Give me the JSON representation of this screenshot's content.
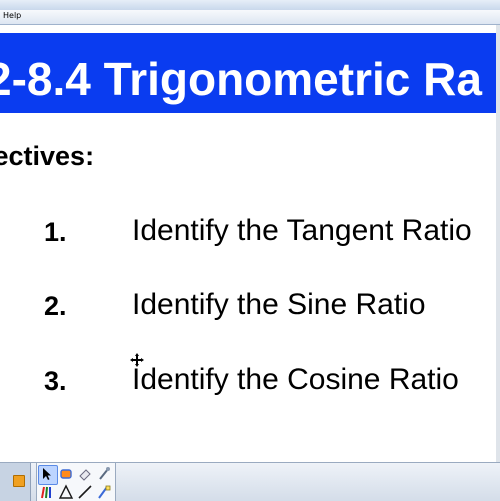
{
  "menubar": {
    "help_label": "Help"
  },
  "slide": {
    "title": "2-8.4 Trigonometric Ra",
    "objectives_heading": "jectives:",
    "items": [
      {
        "num": "1.",
        "text": "Identify the Tangent Ratio"
      },
      {
        "num": "2.",
        "text": "Identify the Sine Ratio"
      },
      {
        "num": "3.",
        "text": "Identify the Cosine Ratio"
      }
    ]
  },
  "colors": {
    "title_bg": "#0a3cf0",
    "title_text": "#ffffff",
    "body_text": "#000000"
  },
  "toolbar": {
    "icons": [
      "lock-icon",
      "select-arrow-icon",
      "pen-icon",
      "eraser-icon",
      "magic-pen-icon",
      "pens-icon",
      "shape-icon",
      "line-icon",
      "highlighter-icon"
    ]
  }
}
